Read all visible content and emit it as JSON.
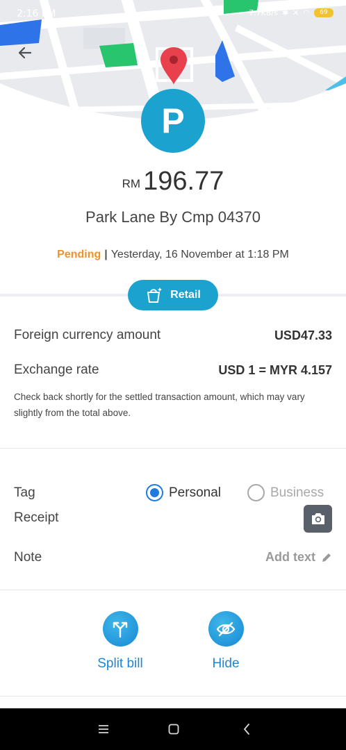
{
  "status_bar": {
    "time": "2:16 PM",
    "network_speed": "7.7KB/s",
    "battery": "69"
  },
  "merchant": {
    "logo_letter": "P",
    "name": "Park Lane By Cmp 04370"
  },
  "amount": {
    "currency": "RM",
    "value": "196.77"
  },
  "transaction_status": {
    "state": "Pending",
    "separator": "|",
    "timestamp": "Yesterday, 16 November at 1:18 PM"
  },
  "category": {
    "label": "Retail"
  },
  "details": {
    "foreign_amount_label": "Foreign currency amount",
    "foreign_amount_value": "USD47.33",
    "exchange_rate_label": "Exchange rate",
    "exchange_rate_value": "USD 1 = MYR 4.157",
    "notice": "Check back shortly for the settled transaction amount, which may vary slightly from the total above."
  },
  "tag": {
    "label": "Tag",
    "options": [
      {
        "label": "Personal",
        "selected": true
      },
      {
        "label": "Business",
        "selected": false
      }
    ]
  },
  "receipt": {
    "label": "Receipt"
  },
  "note": {
    "label": "Note",
    "action": "Add text"
  },
  "actions": [
    {
      "label": "Split bill",
      "icon": "split-icon"
    },
    {
      "label": "Hide",
      "icon": "eye-off-icon"
    }
  ],
  "colors": {
    "accent": "#1ba2cf",
    "pending": "#f0912c",
    "link": "#1b86d8",
    "radio": "#1f7be0"
  }
}
